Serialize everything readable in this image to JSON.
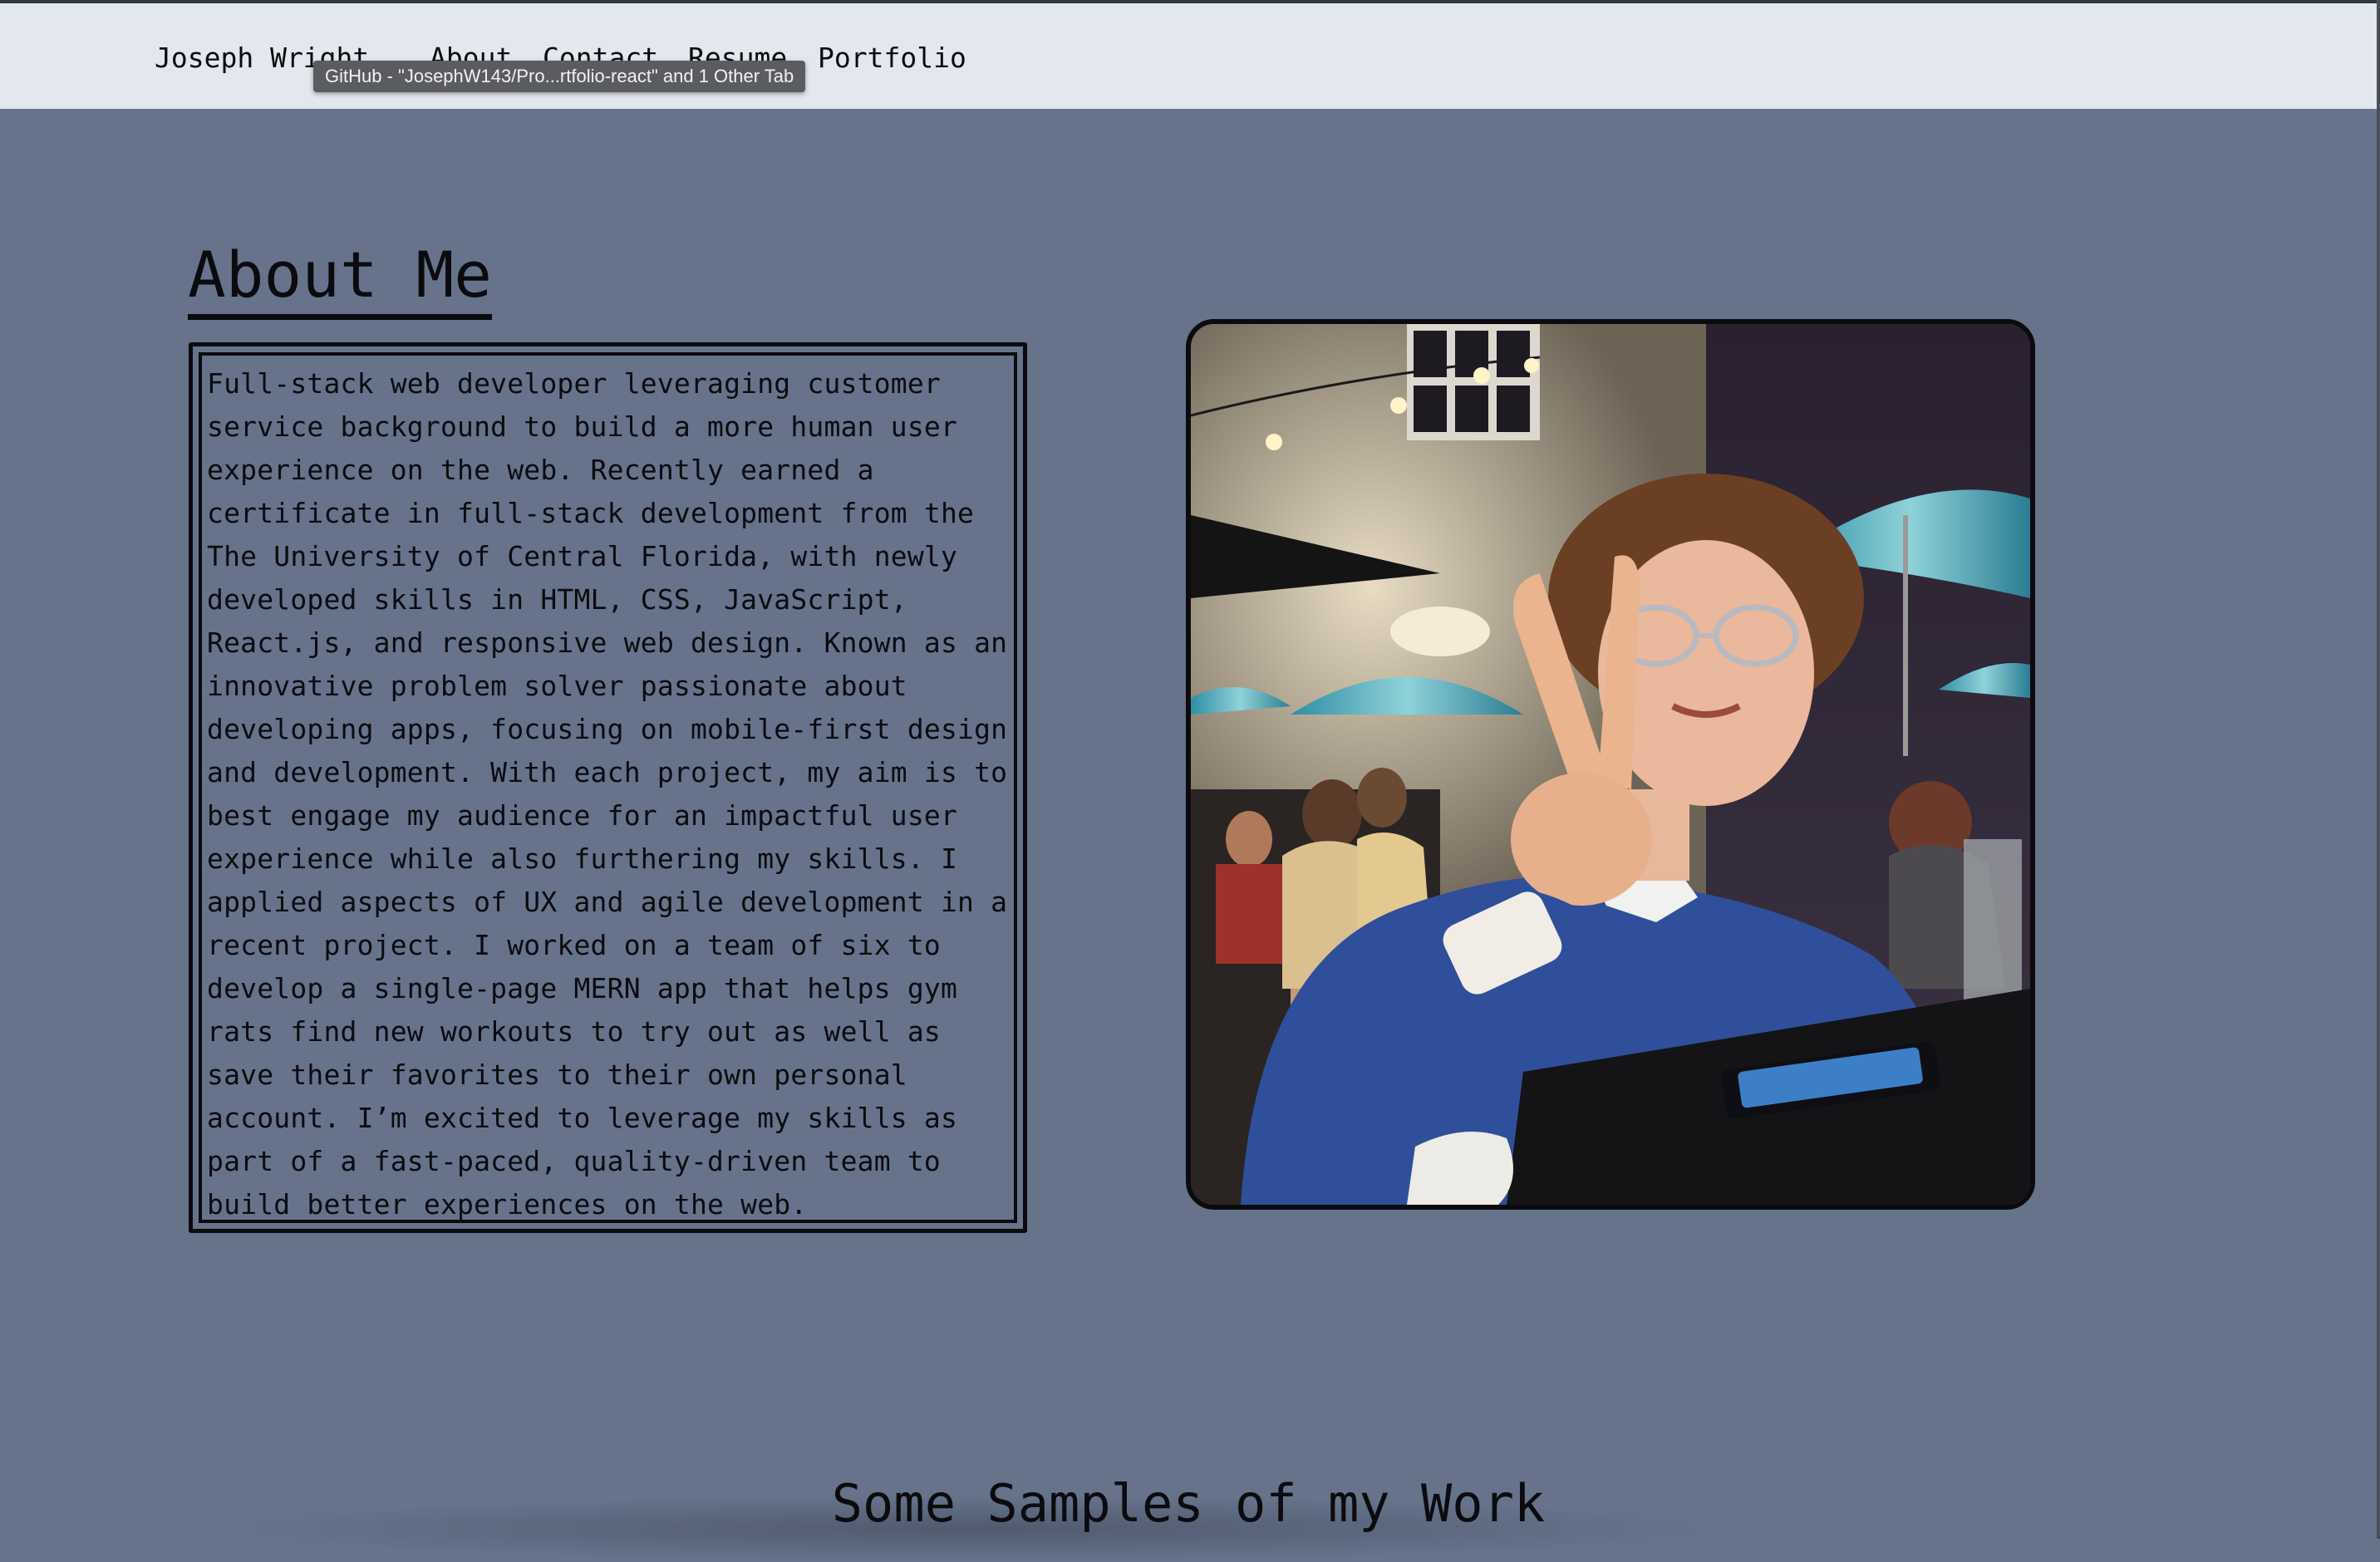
{
  "nav": {
    "brand": "Joseph Wright",
    "links": [
      {
        "label": "About"
      },
      {
        "label": "Contact"
      },
      {
        "label": "Resume"
      },
      {
        "label": "Portfolio"
      }
    ]
  },
  "tooltip": {
    "text": "GitHub - \"JosephW143/Pro...rtfolio-react\" and 1 Other Tab"
  },
  "about": {
    "title": "About Me",
    "body": "Full-stack web developer leveraging customer service background to build a more human user experience on the web. Recently earned a certificate in full-stack development from the The University of Central Florida, with newly developed skills in HTML, CSS, JavaScript, React.js, and responsive web design. Known as an innovative problem solver passionate about developing apps, focusing on mobile-first design and development. With each project, my aim is to best engage my audience for an impactful user experience while also furthering my skills. I applied aspects of UX and agile development in a recent project. I worked on a team of six to develop a single-page MERN app that helps gym rats find new workouts to try out as well as save their favorites to their own personal account. I’m excited to leverage my skills as part of a fast-paced, quality-driven team to build better experiences on the web."
  },
  "samples": {
    "title": "Some Samples of my Work"
  },
  "colors": {
    "page_background": "#66738b",
    "navbar_background": "#e3e7ee",
    "text": "#0b0b0f",
    "tooltip_background": "#5b5c60"
  }
}
